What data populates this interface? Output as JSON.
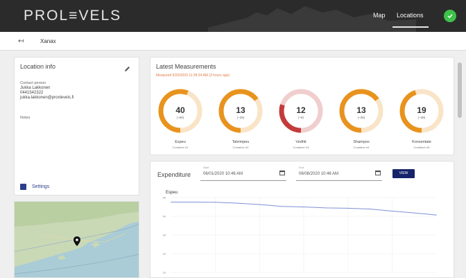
{
  "header": {
    "logo": "PROL≡VELS",
    "nav": [
      {
        "label": "Map"
      },
      {
        "label": "Locations"
      }
    ]
  },
  "subbar": {
    "back_icon": "↤",
    "title": "Xanax"
  },
  "location": {
    "title": "Location info",
    "contact_label": "Contact person",
    "contact_name": "Jukka Lakkonen",
    "phone": "0441542322",
    "email": "jukka.lakkonen@proxlevels.fi",
    "notes_label": "Notes",
    "settings_label": "Settings"
  },
  "measurements": {
    "title": "Latest Measurements",
    "subtitle": "Measured 5/20/2020 11:28:34 AM (3 hours ago)",
    "items": [
      {
        "value": "40",
        "pct": "(~56)",
        "name": "Espeu",
        "desc": "Container #1",
        "level": 0.56,
        "color": "#e8931e"
      },
      {
        "value": "13",
        "pct": "(~35)",
        "name": "Talvimpeu",
        "desc": "Container #2",
        "level": 0.65,
        "color": "#e8931e"
      },
      {
        "value": "12",
        "pct": "(~8)",
        "name": "Vedhit",
        "desc": "Container #3",
        "level": 0.3,
        "color": "#c43b3b"
      },
      {
        "value": "13",
        "pct": "(~35)",
        "name": "Shampoo",
        "desc": "Container #4",
        "level": 0.65,
        "color": "#e8931e"
      },
      {
        "value": "19",
        "pct": "(~38)",
        "name": "Konsentate",
        "desc": "Container #5",
        "level": 0.45,
        "color": "#e8931e"
      }
    ]
  },
  "expenditure": {
    "title": "Expenditure",
    "start_label": "Start",
    "start": "06/01/2020 10:46 AM",
    "end_label": "End",
    "end": "06/08/2020 10:46 AM",
    "view_label": "VIEW"
  },
  "chart_data": {
    "type": "line",
    "title": "Espeu",
    "xlabel": "",
    "ylabel": "",
    "ylim": [
      10,
      50
    ],
    "yticks": [
      "50",
      "40",
      "30",
      "20",
      "10"
    ],
    "x": [
      0,
      1,
      2,
      3,
      4,
      5,
      6,
      7,
      8,
      9,
      10,
      11,
      12
    ],
    "series": [
      {
        "values": [
          47.6,
          47.6,
          47.5,
          47,
          46.3,
          45.3,
          45,
          44.5,
          44.3,
          43.9,
          42.8,
          41.8,
          40.7
        ]
      }
    ]
  }
}
